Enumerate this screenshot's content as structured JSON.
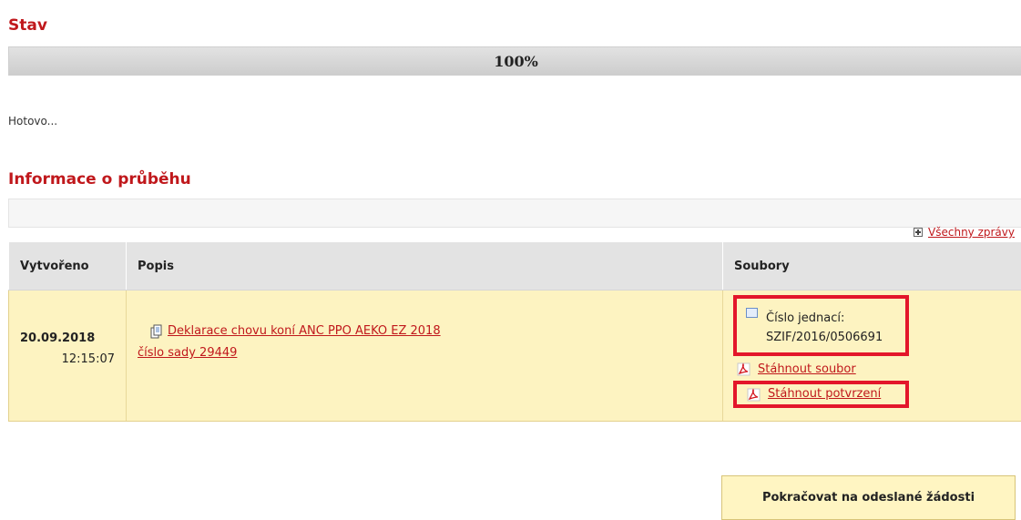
{
  "status": {
    "title": "Stav",
    "progress_text": "100%",
    "progress_fraction": 1.0,
    "message": "Hotovo..."
  },
  "info": {
    "title": "Informace o průběhu",
    "all_messages_link": "Všechny zprávy"
  },
  "table": {
    "headers": {
      "created": "Vytvořeno",
      "description": "Popis",
      "files": "Soubory"
    },
    "rows": [
      {
        "date": "20.09.2018",
        "time": "12:15:07",
        "description_line1": "Deklarace chovu koní ANC PPO AEKO EZ 2018",
        "description_line2": "číslo sady 29449",
        "ref_label": "Číslo jednací:",
        "ref_value": "SZIF/2016/0506691",
        "download_file": "Stáhnout soubor",
        "download_confirmation": "Stáhnout potvrzení"
      }
    ]
  },
  "actions": {
    "continue_label": "Pokračovat na odeslané žádosti"
  },
  "icons": {
    "expand": "plus-box-icon",
    "document": "document-icon",
    "reference": "square-icon",
    "pdf": "pdf-icon"
  },
  "colors": {
    "heading": "#c0181c",
    "row_background": "#fdf3c1",
    "highlight_border": "#e3162a",
    "button_background": "#fff5c2"
  }
}
